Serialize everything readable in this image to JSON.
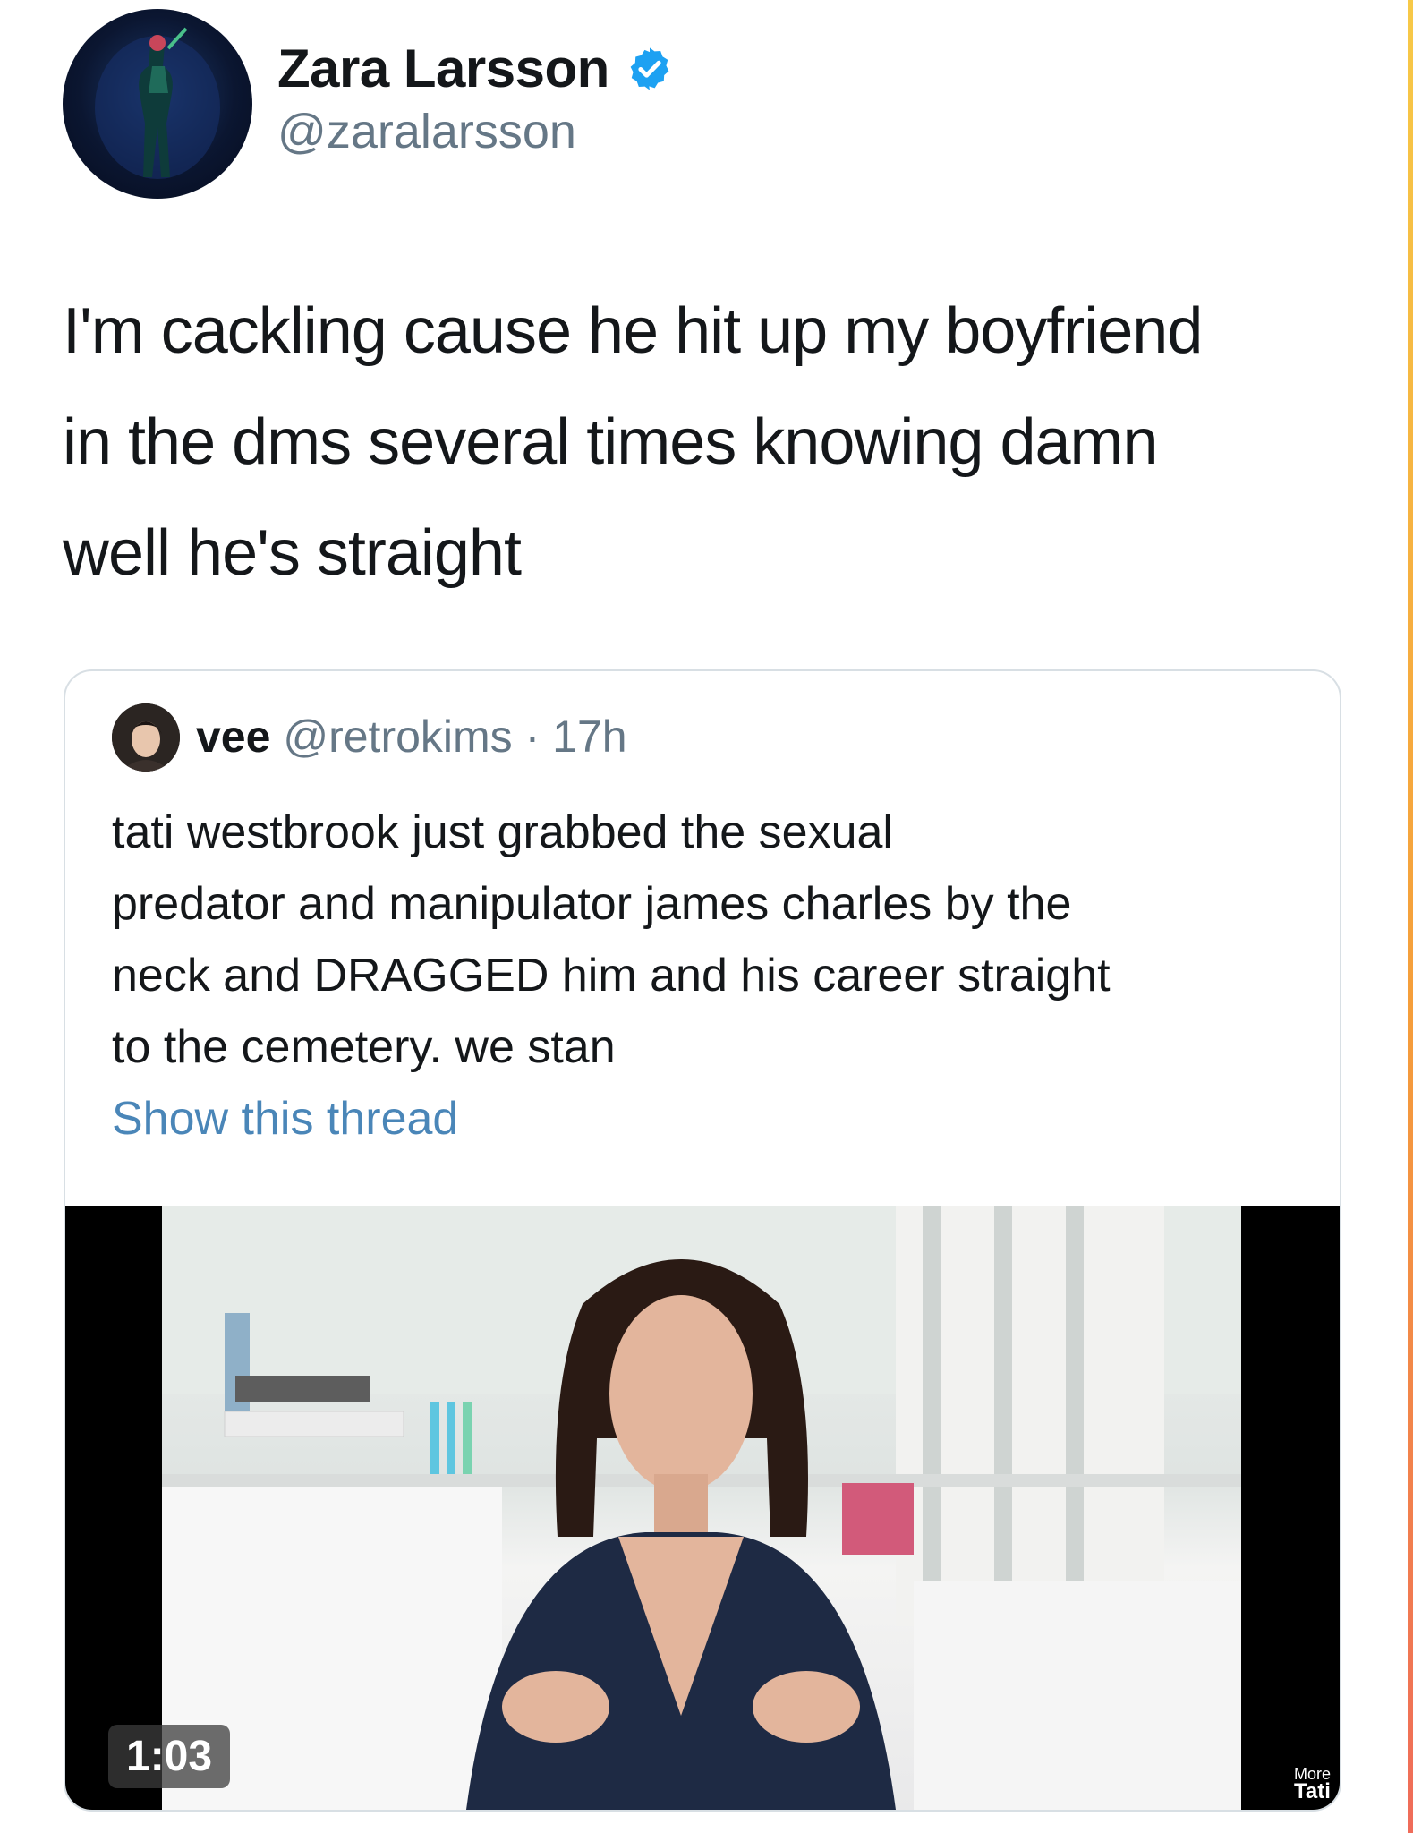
{
  "author": {
    "display_name": "Zara Larsson",
    "handle": "@zaralarsson",
    "verified": true,
    "avatar_icon": "profile-photo"
  },
  "tweet": {
    "text": "I'm cackling cause he hit up my boyfriend in the dms several times knowing damn well he's straight"
  },
  "quoted_tweet": {
    "name": "vee",
    "handle": "@retrokims",
    "separator": "·",
    "time": "17h",
    "text": "tati westbrook just grabbed the  sexual\npredator and manipulator james charles by the\nneck and DRAGGED him and his career straight\nto the cemetery. we stan",
    "show_thread_label": "Show this thread",
    "video": {
      "duration": "1:03",
      "overlay_label_top": "More",
      "overlay_label_bottom": "Tati"
    }
  },
  "colors": {
    "verified_blue": "#1da1f2",
    "link_blue": "#4a86b8",
    "secondary_text": "#657786",
    "border": "#d8dfe4"
  }
}
